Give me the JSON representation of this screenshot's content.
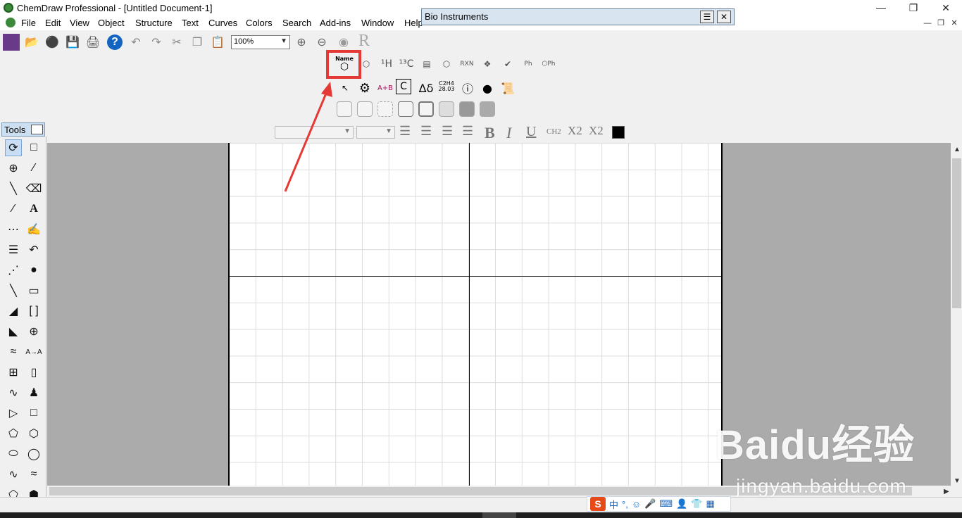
{
  "window": {
    "title": "ChemDraw Professional - [Untitled Document-1]",
    "minimize_icon": "minimize-icon",
    "restore_icon": "restore-icon",
    "close_icon": "close-icon"
  },
  "menu": {
    "items": [
      "File",
      "Edit",
      "View",
      "Object",
      "Structure",
      "Text",
      "Curves",
      "Colors",
      "Search",
      "Add-ins",
      "Window",
      "Help"
    ]
  },
  "main_toolbar": {
    "zoom_value": "100%"
  },
  "bio_instruments": {
    "title": "Bio Instruments",
    "name_icon_label": "Name",
    "icons": [
      "name-to-structure-icon",
      "structure-to-name-icon",
      "proton-nmr-icon",
      "carbon-nmr-icon",
      "analysis-icon",
      "check-structure-icon",
      "reaction-icon",
      "clean-icon",
      "check-icon",
      "ph-icon",
      "ph-ring-icon"
    ],
    "row2_labels": {
      "ab": "A+B",
      "c": "C",
      "delta": "Δδ",
      "formula_top": "C2H4",
      "formula_bottom": "28.03"
    }
  },
  "format_bar": {
    "bold": "B",
    "italic": "I",
    "underline": "U",
    "ch2": "CH2",
    "x2_sub": "X2",
    "x2_sup": "X2",
    "color": "#000000"
  },
  "tools": {
    "title": "Tools",
    "rows": [
      [
        "lasso-tool-icon",
        "marquee-tool-icon"
      ],
      [
        "structure-perspective-icon",
        "chain-tool-icon"
      ],
      [
        "solid-bond-icon",
        "eraser-icon"
      ],
      [
        "double-bond-icon",
        "text-tool-icon"
      ],
      [
        "dashed-bond-icon",
        "pen-tool-icon"
      ],
      [
        "hashed-bond-icon",
        "arrow-tool-icon"
      ],
      [
        "hashed-wedge-icon",
        "orbital-icon"
      ],
      [
        "bold-bond-icon",
        "rectangle-icon"
      ],
      [
        "wedge-bond-icon",
        "bracket-icon"
      ],
      [
        "wedge-hash-icon",
        "charge-icon"
      ],
      [
        "wavy-bond-icon",
        "atom-map-icon"
      ],
      [
        "table-icon",
        "tlc-plate-icon"
      ],
      [
        "spectrum-icon",
        "stamp-icon"
      ],
      [
        "triangle-icon",
        "square-icon"
      ],
      [
        "pentagon-icon",
        "hexagon-icon"
      ],
      [
        "heptagon-icon",
        "octagon-icon"
      ],
      [
        "chair-1-icon",
        "chair-2-icon"
      ],
      [
        "cyclopentane-icon",
        "benzene-icon"
      ]
    ]
  },
  "ime": {
    "logo": "S",
    "lang": "中"
  },
  "watermark": {
    "brand": "Baidu经验",
    "url": "jingyan.baidu.com"
  }
}
